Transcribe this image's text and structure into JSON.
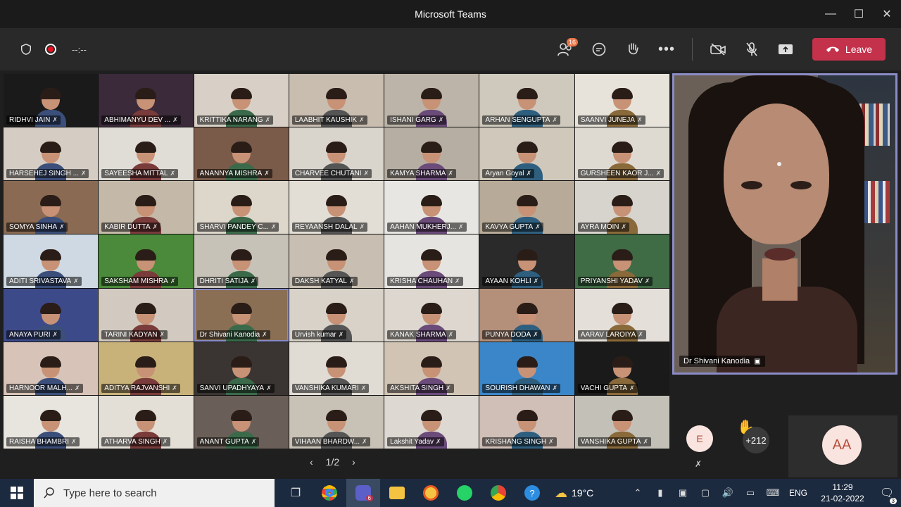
{
  "window": {
    "title": "Microsoft Teams"
  },
  "toolbar": {
    "timer": "--:--",
    "participants_badge": "16",
    "leave_label": "Leave"
  },
  "participants": [
    {
      "name": "RIDHVI JAIN",
      "bg": "#1a1a1a"
    },
    {
      "name": "ABHIMANYU DEV ...",
      "bg": "#3a2a3a"
    },
    {
      "name": "KRITTIKA NARANG",
      "bg": "#d8d0c6"
    },
    {
      "name": "LAABHIT KAUSHIK",
      "bg": "#c9bdb0"
    },
    {
      "name": "ISHANI GARG",
      "bg": "#bcb4a8"
    },
    {
      "name": "ARHAN SENGUPTA",
      "bg": "#cfc9bd"
    },
    {
      "name": "SAANVI JUNEJA",
      "bg": "#e7e3da"
    },
    {
      "name": "HARSEHEJ SINGH ...",
      "bg": "#d5cdc4"
    },
    {
      "name": "SAYEESHA MITTAL",
      "bg": "#e0dcd6"
    },
    {
      "name": "ANANNYA MISHRA",
      "bg": "#7a5a48"
    },
    {
      "name": "CHARVEE CHUTANI",
      "bg": "#d9d4cc"
    },
    {
      "name": "KAMYA SHARMA",
      "bg": "#b6aea2"
    },
    {
      "name": "Aryan Goyal",
      "bg": "#cfc8bb"
    },
    {
      "name": "GURSHEEN KAOR J...",
      "bg": "#dedad2"
    },
    {
      "name": "SOMYA SINHA",
      "bg": "#8a6a52"
    },
    {
      "name": "KABIR DUTTA",
      "bg": "#c4b9a8"
    },
    {
      "name": "SHARVI PANDEY C...",
      "bg": "#ddd6cb"
    },
    {
      "name": "REYAANSH DALAL",
      "bg": "#e2ddd5"
    },
    {
      "name": "AAHAN MUKHERJ...",
      "bg": "#e8e6e3"
    },
    {
      "name": "KAVYA GUPTA",
      "bg": "#b8aa98"
    },
    {
      "name": "AYRA MOIN",
      "bg": "#d7d3cd"
    },
    {
      "name": "ADITI SRIVASTAVA",
      "bg": "#cfd9e3"
    },
    {
      "name": "SAKSHAM MISHRA",
      "bg": "#4a8a3a"
    },
    {
      "name": "DHRITI SATIJA",
      "bg": "#c7c2b8"
    },
    {
      "name": "DAKSH KATYAL",
      "bg": "#c8bfb2"
    },
    {
      "name": "KRISHA CHAUHAN",
      "bg": "#e6e4e0"
    },
    {
      "name": "AYAAN KOHLI",
      "bg": "#2a2a2a"
    },
    {
      "name": "PRIYANSHI YADAV",
      "bg": "#3f6b45"
    },
    {
      "name": "ANAYA PURI",
      "bg": "#3d4a8a"
    },
    {
      "name": "TARINI KADYAN",
      "bg": "#d2cac0"
    },
    {
      "name": "Dr Shivani Kanodia",
      "bg": "#8a6f55"
    },
    {
      "name": "Urvish kumar",
      "bg": "#d9d2c8"
    },
    {
      "name": "KANAK SHARMA",
      "bg": "#ddd7cf"
    },
    {
      "name": "PUNYA DODA",
      "bg": "#b48f7a"
    },
    {
      "name": "AARAV LAROIYA",
      "bg": "#e4dfd8"
    },
    {
      "name": "HARNOOR MALH...",
      "bg": "#d8c3b8"
    },
    {
      "name": "ADITYA RAJVANSHI",
      "bg": "#c9b27a"
    },
    {
      "name": "SANVI UPADHYAYA",
      "bg": "#3a3532"
    },
    {
      "name": "VANSHIKA KUMARI",
      "bg": "#e0dbd3"
    },
    {
      "name": "AKSHITA SINGH",
      "bg": "#d1c4b4"
    },
    {
      "name": "SOURISH DHAWAN",
      "bg": "#3a86c8"
    },
    {
      "name": "VACHI GUPTA",
      "bg": "#1a1a1a"
    },
    {
      "name": "RAISHA BHAMBRI",
      "bg": "#e8e4de"
    },
    {
      "name": "ATHARVA SINGH",
      "bg": "#e3ded6"
    },
    {
      "name": "ANANT GUPTA",
      "bg": "#6a5f58"
    },
    {
      "name": "VIHAAN BHARDW...",
      "bg": "#c8c1b6"
    },
    {
      "name": "Lakshit Yadav",
      "bg": "#ddd8d1"
    },
    {
      "name": "KRISHANG SINGH",
      "bg": "#d0bfb6"
    },
    {
      "name": "VANSHIKA GUPTA",
      "bg": "#c3c0b8"
    }
  ],
  "pager": {
    "label": "1/2"
  },
  "spotlight": {
    "name": "Dr Shivani Kanodia"
  },
  "overflow": {
    "avatar_initial": "E",
    "more_count": "+212",
    "self_initials": "AA"
  },
  "taskbar": {
    "search_placeholder": "Type here to search",
    "teams_badge": "6",
    "temperature": "19°C",
    "language": "ENG",
    "time": "11:29",
    "date": "21-02-2022",
    "notifications": "3"
  }
}
